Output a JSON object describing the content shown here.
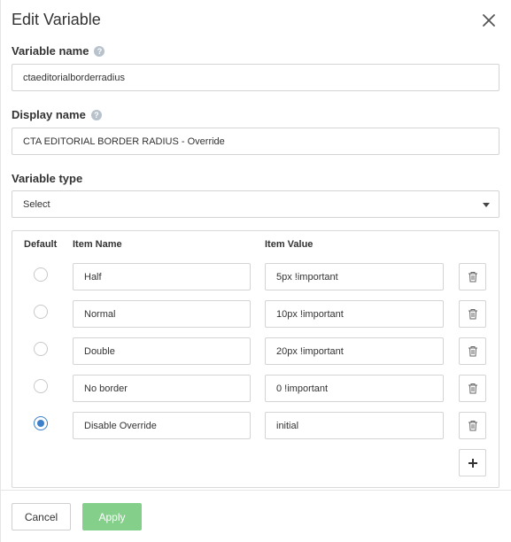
{
  "dialog": {
    "title": "Edit Variable",
    "close_icon": "close-icon"
  },
  "variable_name": {
    "label": "Variable name",
    "help_icon": "help-icon",
    "value": "ctaeditorialborderradius"
  },
  "display_name": {
    "label": "Display name",
    "help_icon": "help-icon",
    "value": "CTA EDITORIAL BORDER RADIUS - Override"
  },
  "variable_type": {
    "label": "Variable type",
    "selected": "Select",
    "icon": "caret-down-icon"
  },
  "items_table": {
    "headers": {
      "default": "Default",
      "item_name": "Item Name",
      "item_value": "Item Value"
    },
    "rows": [
      {
        "name": "Half",
        "value": "5px !important",
        "default": false
      },
      {
        "name": "Normal",
        "value": "10px !important",
        "default": false
      },
      {
        "name": "Double",
        "value": "20px !important",
        "default": false
      },
      {
        "name": "No border",
        "value": "0 !important",
        "default": false
      },
      {
        "name": "Disable Override",
        "value": "initial",
        "default": true
      }
    ],
    "row_action_icon": "trash-icon",
    "add_icon": "plus-icon"
  },
  "footer": {
    "cancel_label": "Cancel",
    "apply_label": "Apply"
  },
  "colors": {
    "accent": "#3d7fc9",
    "apply": "#84cf8a",
    "border": "#d4d4d4"
  }
}
